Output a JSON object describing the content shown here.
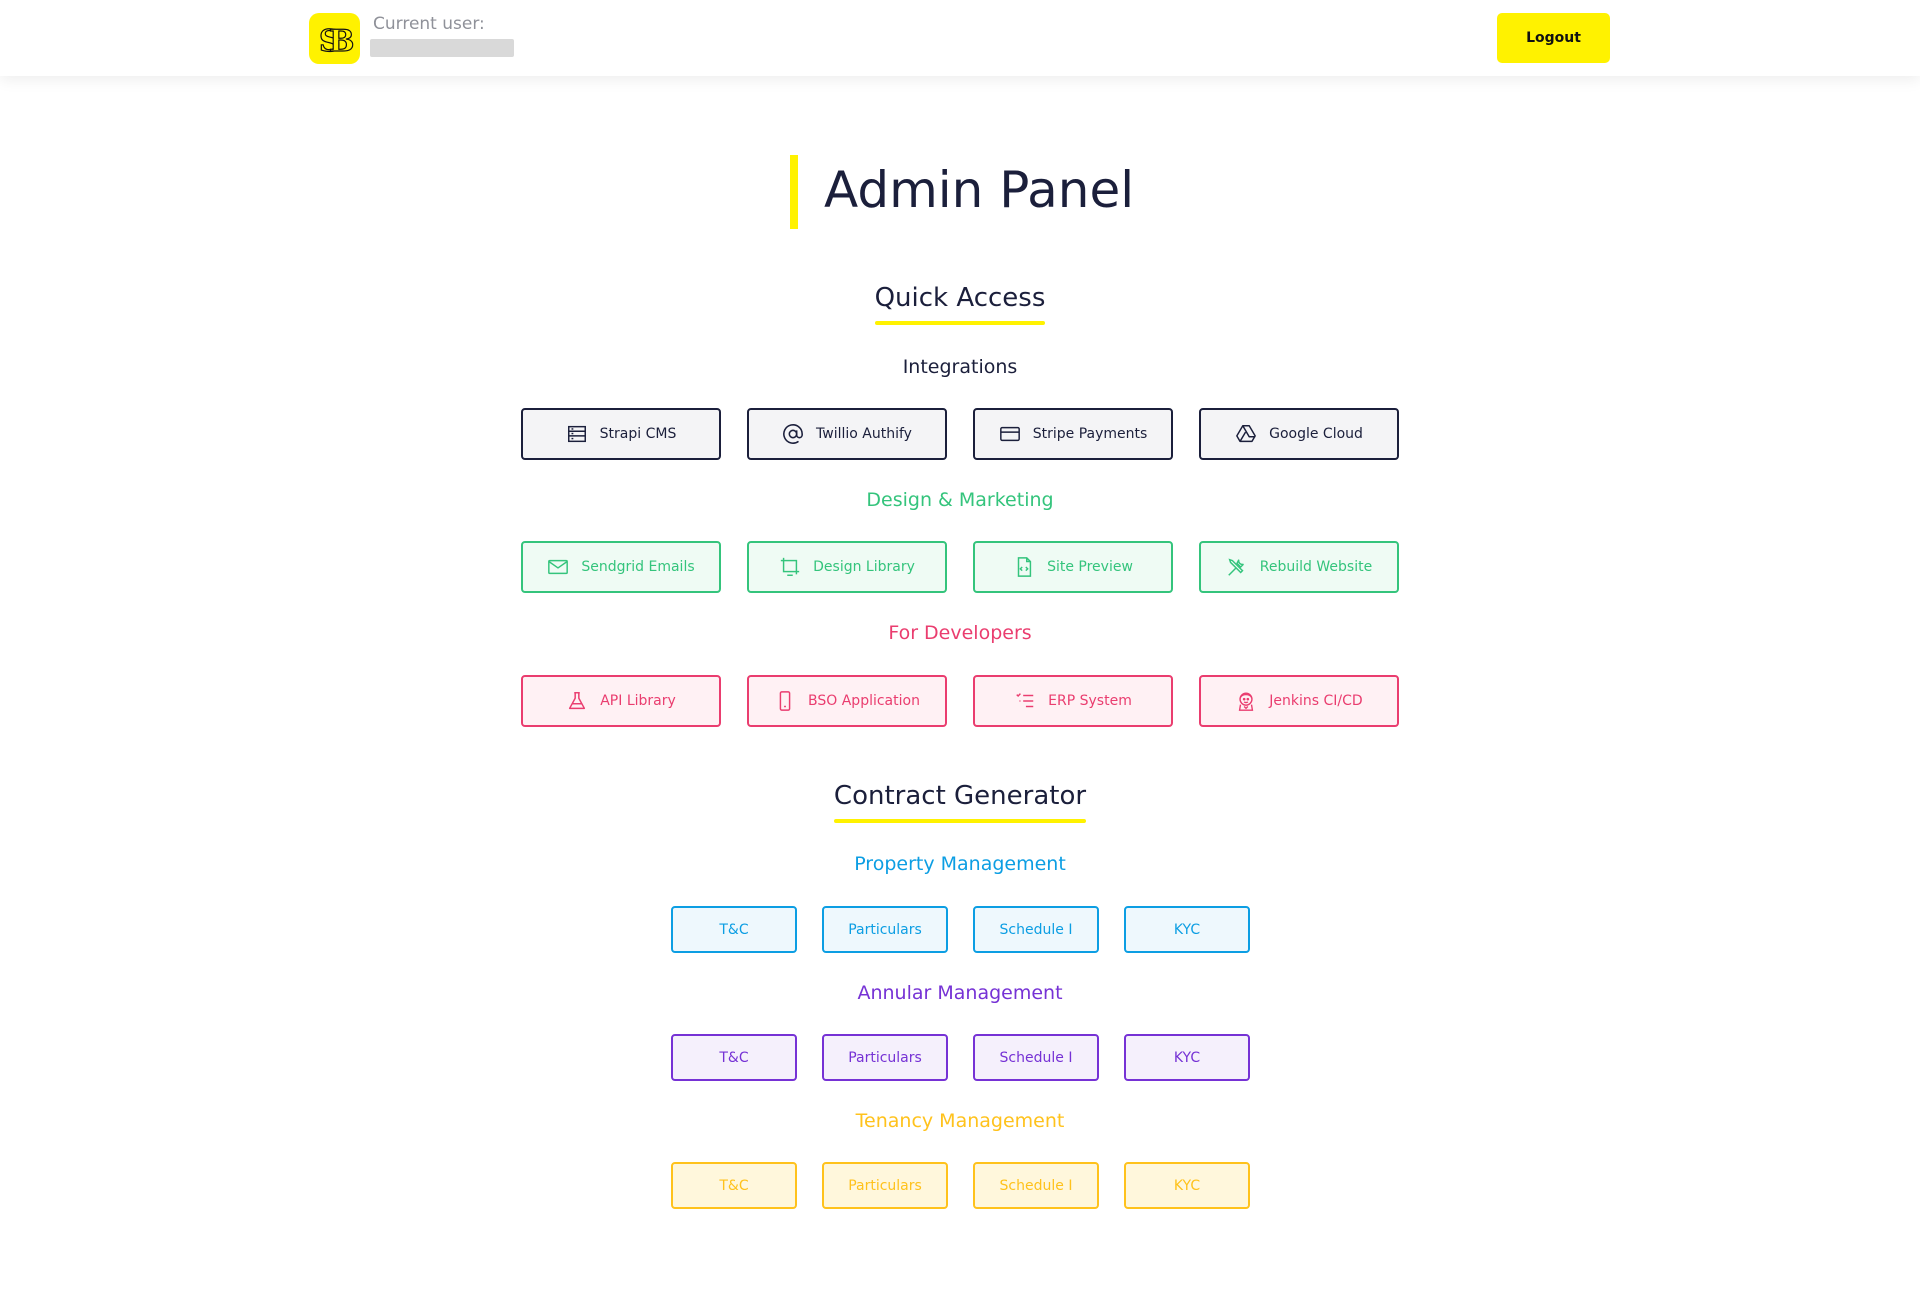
{
  "header": {
    "current_user_label": "Current user:",
    "current_user_value": "",
    "logout_label": "Logout"
  },
  "title": "Admin Panel",
  "quick_access": {
    "title": "Quick Access",
    "integrations": {
      "title": "Integrations",
      "items": [
        {
          "label": "Strapi CMS",
          "icon": "server-icon"
        },
        {
          "label": "Twillio Authify",
          "icon": "at-sign-icon"
        },
        {
          "label": "Stripe Payments",
          "icon": "credit-card-icon"
        },
        {
          "label": "Google Cloud",
          "icon": "google-drive-icon"
        }
      ]
    },
    "design_marketing": {
      "title": "Design & Marketing",
      "items": [
        {
          "label": "Sendgrid Emails",
          "icon": "envelope-icon"
        },
        {
          "label": "Design Library",
          "icon": "frame-icon"
        },
        {
          "label": "Site Preview",
          "icon": "code-file-icon"
        },
        {
          "label": "Rebuild Website",
          "icon": "tools-icon"
        }
      ]
    },
    "developers": {
      "title": "For Developers",
      "items": [
        {
          "label": "API Library",
          "icon": "flask-icon"
        },
        {
          "label": "BSO Application",
          "icon": "smartphone-icon"
        },
        {
          "label": "ERP System",
          "icon": "list-check-icon"
        },
        {
          "label": "Jenkins CI/CD",
          "icon": "butler-icon"
        }
      ]
    }
  },
  "contract_generator": {
    "title": "Contract Generator",
    "property": {
      "title": "Property Management",
      "items": [
        "T&C",
        "Particulars",
        "Schedule I",
        "KYC"
      ]
    },
    "annular": {
      "title": "Annular Management",
      "items": [
        "T&C",
        "Particulars",
        "Schedule I",
        "KYC"
      ]
    },
    "tenancy": {
      "title": "Tenancy Management",
      "items": [
        "T&C",
        "Particulars",
        "Schedule I",
        "KYC"
      ]
    }
  },
  "colors": {
    "accent_yellow": "#fff200",
    "dark": "#1b1f3b",
    "green": "#34c47c",
    "red": "#ea3d6f",
    "blue": "#0c9ee3",
    "purple": "#7632d5",
    "amber": "#ffc21c"
  }
}
